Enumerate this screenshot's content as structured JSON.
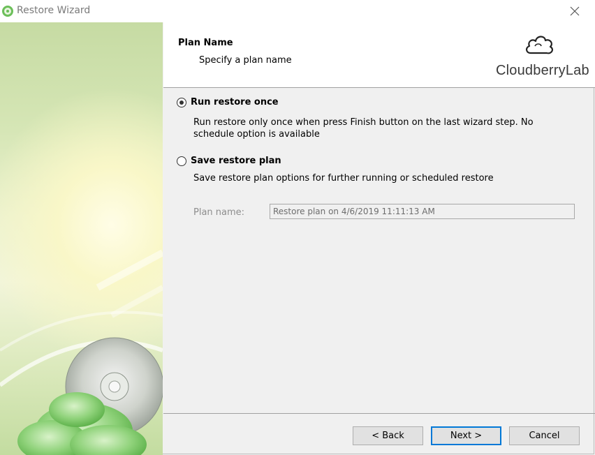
{
  "window": {
    "title": "Restore Wizard",
    "icon": "green-cloud-disc-icon",
    "close_icon": "close-icon"
  },
  "header": {
    "title": "Plan Name",
    "subtitle": "Specify a plan name",
    "logo_text": "CloudberryLab"
  },
  "options": [
    {
      "label": "Run restore once",
      "checked": true,
      "description": "Run restore only once when press Finish button on the last wizard step. No schedule option is available"
    },
    {
      "label": "Save restore plan",
      "checked": false,
      "description": "Save restore plan options for further running or scheduled restore"
    }
  ],
  "plan_name": {
    "label": "Plan name:",
    "value": "Restore plan on 4/6/2019 11:11:13 AM",
    "enabled": false
  },
  "buttons": {
    "back": "< Back",
    "next": "Next >",
    "cancel": "Cancel"
  },
  "colors": {
    "accent": "#0078d7",
    "panel_green": "#c6dba3"
  }
}
